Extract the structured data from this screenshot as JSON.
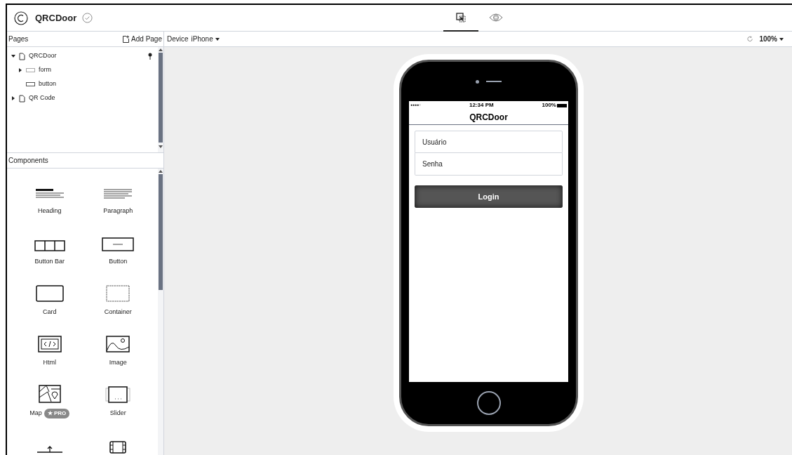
{
  "app": {
    "title": "QRCDoor",
    "saved": true
  },
  "mode_tabs": [
    {
      "kind": "design",
      "selected": true
    },
    {
      "kind": "preview",
      "selected": false
    }
  ],
  "pages_panel": {
    "title": "Pages",
    "add_label": "Add Page",
    "tree": [
      {
        "label": "QRCDoor",
        "kind": "page",
        "expanded": true,
        "pinned": true,
        "children": [
          {
            "label": "form",
            "kind": "form",
            "expanded": false
          },
          {
            "label": "button",
            "kind": "button"
          }
        ]
      },
      {
        "label": "QR Code",
        "kind": "page",
        "expanded": false,
        "pinned": false
      }
    ]
  },
  "components_panel": {
    "title": "Components",
    "items": [
      {
        "kind": "heading",
        "label": "Heading"
      },
      {
        "kind": "paragraph",
        "label": "Paragraph"
      },
      {
        "kind": "buttonbar",
        "label": "Button Bar"
      },
      {
        "kind": "button",
        "label": "Button"
      },
      {
        "kind": "card",
        "label": "Card"
      },
      {
        "kind": "container",
        "label": "Container"
      },
      {
        "kind": "html",
        "label": "Html"
      },
      {
        "kind": "image",
        "label": "Image"
      },
      {
        "kind": "map",
        "label": "Map",
        "badge": "★ PRO"
      },
      {
        "kind": "slider",
        "label": "Slider"
      },
      {
        "kind": "divider"
      },
      {
        "kind": "video"
      }
    ]
  },
  "canvas_toolbar": {
    "device_label": "Device",
    "device": "iPhone",
    "zoom": "100%"
  },
  "phone": {
    "status_bar": {
      "carrier": "●●●●○",
      "time": "12:34 PM",
      "battery": "100%"
    },
    "nav_title": "QRCDoor",
    "fields": [
      {
        "placeholder": "Usuário"
      },
      {
        "placeholder": "Senha"
      }
    ],
    "button": "Login"
  }
}
